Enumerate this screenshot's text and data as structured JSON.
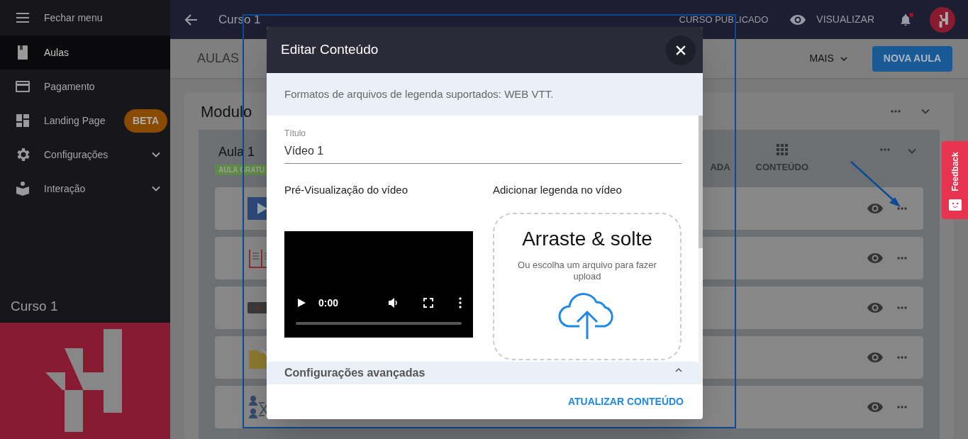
{
  "sidebar": {
    "toggle": {
      "label": "Fechar menu"
    },
    "items": [
      {
        "label": "Aulas",
        "selected": true,
        "expandable": false
      },
      {
        "label": "Pagamento",
        "selected": false,
        "expandable": false
      },
      {
        "label": "Landing Page",
        "selected": false,
        "expandable": false,
        "badge": "BETA"
      },
      {
        "label": "Configurações",
        "selected": false,
        "expandable": true
      },
      {
        "label": "Interação",
        "selected": false,
        "expandable": true
      }
    ],
    "course_title": "Curso 1"
  },
  "topbar": {
    "course_name": "Curso 1",
    "status": "CURSO PUBLICADO",
    "preview": "VISUALIZAR",
    "notifications_unread": true
  },
  "toolbar": {
    "title": "AULAS",
    "more": "MAIS",
    "new_button": "NOVA AULA"
  },
  "module": {
    "title": "Modulo",
    "lesson": {
      "title": "Aula 1",
      "badge": "AULA GRATU",
      "tabs": [
        {
          "label": "ADA"
        },
        {
          "label": "CONTEÚDO"
        }
      ],
      "contents": [
        {
          "kind": "video"
        },
        {
          "kind": "text"
        },
        {
          "kind": "recording"
        },
        {
          "kind": "file"
        },
        {
          "kind": "diagram"
        }
      ]
    }
  },
  "feedback": {
    "label": "Feedback"
  },
  "modal": {
    "title": "Editar Conteúdo",
    "info": "Formatos de arquivos de legenda suportados: WEB VTT.",
    "title_field": {
      "label": "Título",
      "value": "Vídeo 1"
    },
    "preview": {
      "heading": "Pré-Visualização do vídeo",
      "time": "0:00"
    },
    "subtitle": {
      "heading": "Adicionar legenda no vídeo",
      "drop_title": "Arraste & solte",
      "drop_hint": "Ou escolha um arquivo para fazer upload"
    },
    "advanced": {
      "label": "Configurações avançadas",
      "expanded": true
    },
    "submit": "ATUALIZAR CONTEÚDO"
  }
}
